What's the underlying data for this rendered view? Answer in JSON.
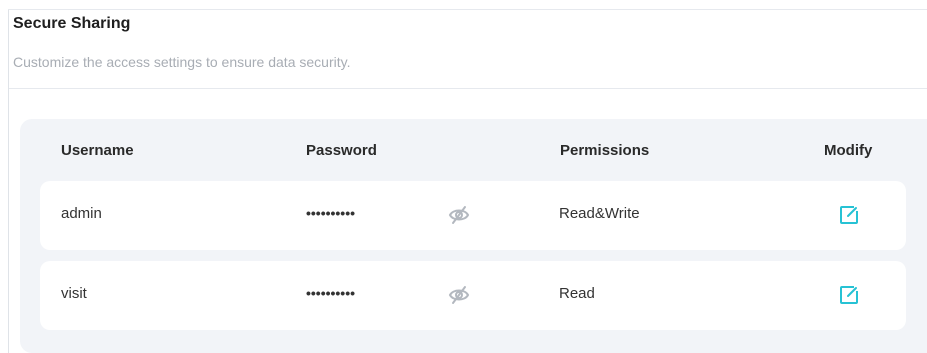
{
  "section": {
    "title": "Secure Sharing",
    "subtitle": "Customize the access settings to ensure data security."
  },
  "table": {
    "headers": {
      "username": "Username",
      "password": "Password",
      "permissions": "Permissions",
      "modify": "Modify"
    },
    "rows": [
      {
        "username": "admin",
        "password": "••••••••••",
        "permissions": "Read&Write",
        "password_icon": "eye-slash-icon",
        "modify_icon": "edit-icon"
      },
      {
        "username": "visit",
        "password": "••••••••••",
        "permissions": "Read",
        "password_icon": "eye-slash-icon",
        "modify_icon": "edit-icon"
      }
    ]
  },
  "colors": {
    "accent": "#27c2d4",
    "muted_icon": "#b3b8bf",
    "card_bg": "#f2f4f8"
  }
}
